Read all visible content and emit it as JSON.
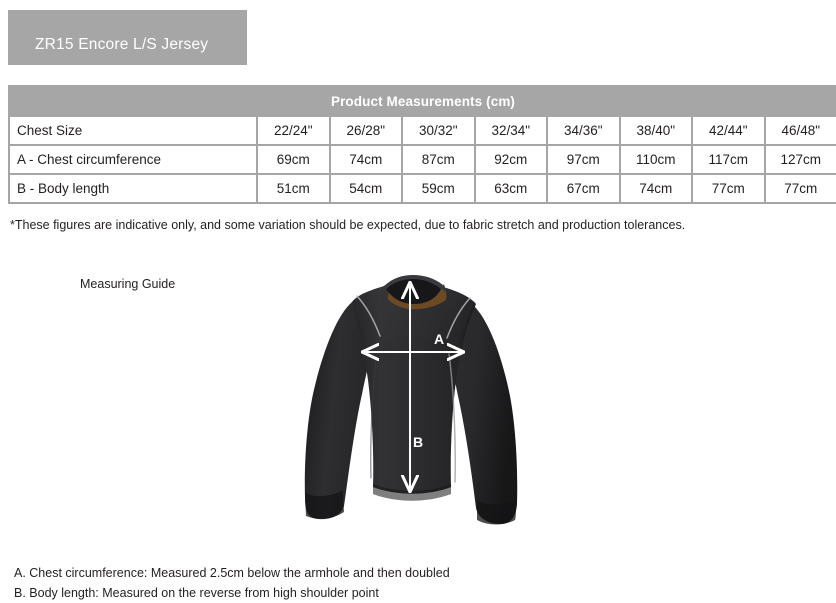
{
  "product": {
    "title": "ZR15 Encore L/S Jersey"
  },
  "table": {
    "caption": "Product Measurements (cm)",
    "row_labels": [
      "Chest Size",
      "A - Chest circumference",
      "B - Body length"
    ],
    "chest_sizes": [
      "22/24\"",
      "26/28\"",
      "30/32\"",
      "32/34\"",
      "34/36\"",
      "38/40\"",
      "42/44\"",
      "46/48\""
    ],
    "chest_circumference": [
      "69cm",
      "74cm",
      "87cm",
      "92cm",
      "97cm",
      "110cm",
      "117cm",
      "127cm"
    ],
    "body_length": [
      "51cm",
      "54cm",
      "59cm",
      "63cm",
      "67cm",
      "74cm",
      "77cm",
      "77cm"
    ]
  },
  "notes": {
    "indicative": "*These figures are indicative only, and some variation should be expected, due to fabric stretch and production tolerances.",
    "measuring_guide_label": "Measuring Guide",
    "definition_a": "A. Chest circumference: Measured 2.5cm below the armhole and then doubled",
    "definition_b": "B. Body length: Measured on the reverse from high shoulder point"
  },
  "figure": {
    "arrow_a_label": "A",
    "arrow_b_label": "B",
    "garment_color": "#2b2b2d",
    "arrow_color": "#ffffff",
    "collar_lining_color": "#7a5226"
  },
  "colors": {
    "header_gray": "#a6a6a6",
    "text": "#231f20",
    "background": "#ffffff"
  }
}
